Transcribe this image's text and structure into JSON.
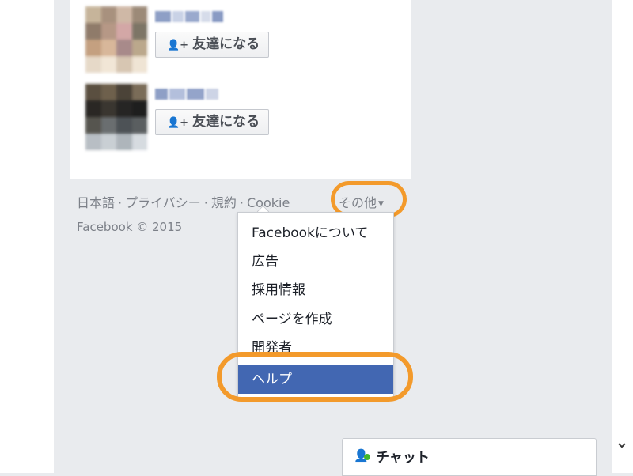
{
  "suggestions": {
    "people": [
      {
        "add_friend_label": "友達になる"
      },
      {
        "add_friend_label": "友達になる"
      }
    ]
  },
  "footer": {
    "links": [
      "日本語",
      "プライバシー",
      "規約",
      "Cookie"
    ],
    "separator": "·",
    "more_label": "その他",
    "copyright": "Facebook © 2015"
  },
  "more_menu": {
    "items": [
      "Facebookについて",
      "広告",
      "採用情報",
      "ページを作成",
      "開発者",
      "ヘルプ"
    ],
    "highlighted_item": "ヘルプ"
  },
  "chat": {
    "label": "チャット"
  },
  "icons": {
    "add_friend": "person-plus-icon",
    "more_caret": "caret-down-icon",
    "chat_person": "person-icon",
    "scroll_down": "chevron-down-icon"
  },
  "colors": {
    "page_bg": "#e9ebee",
    "menu_highlight": "#4267b2",
    "annotation_ring": "#f39a2b",
    "online_dot": "#42b72a"
  }
}
